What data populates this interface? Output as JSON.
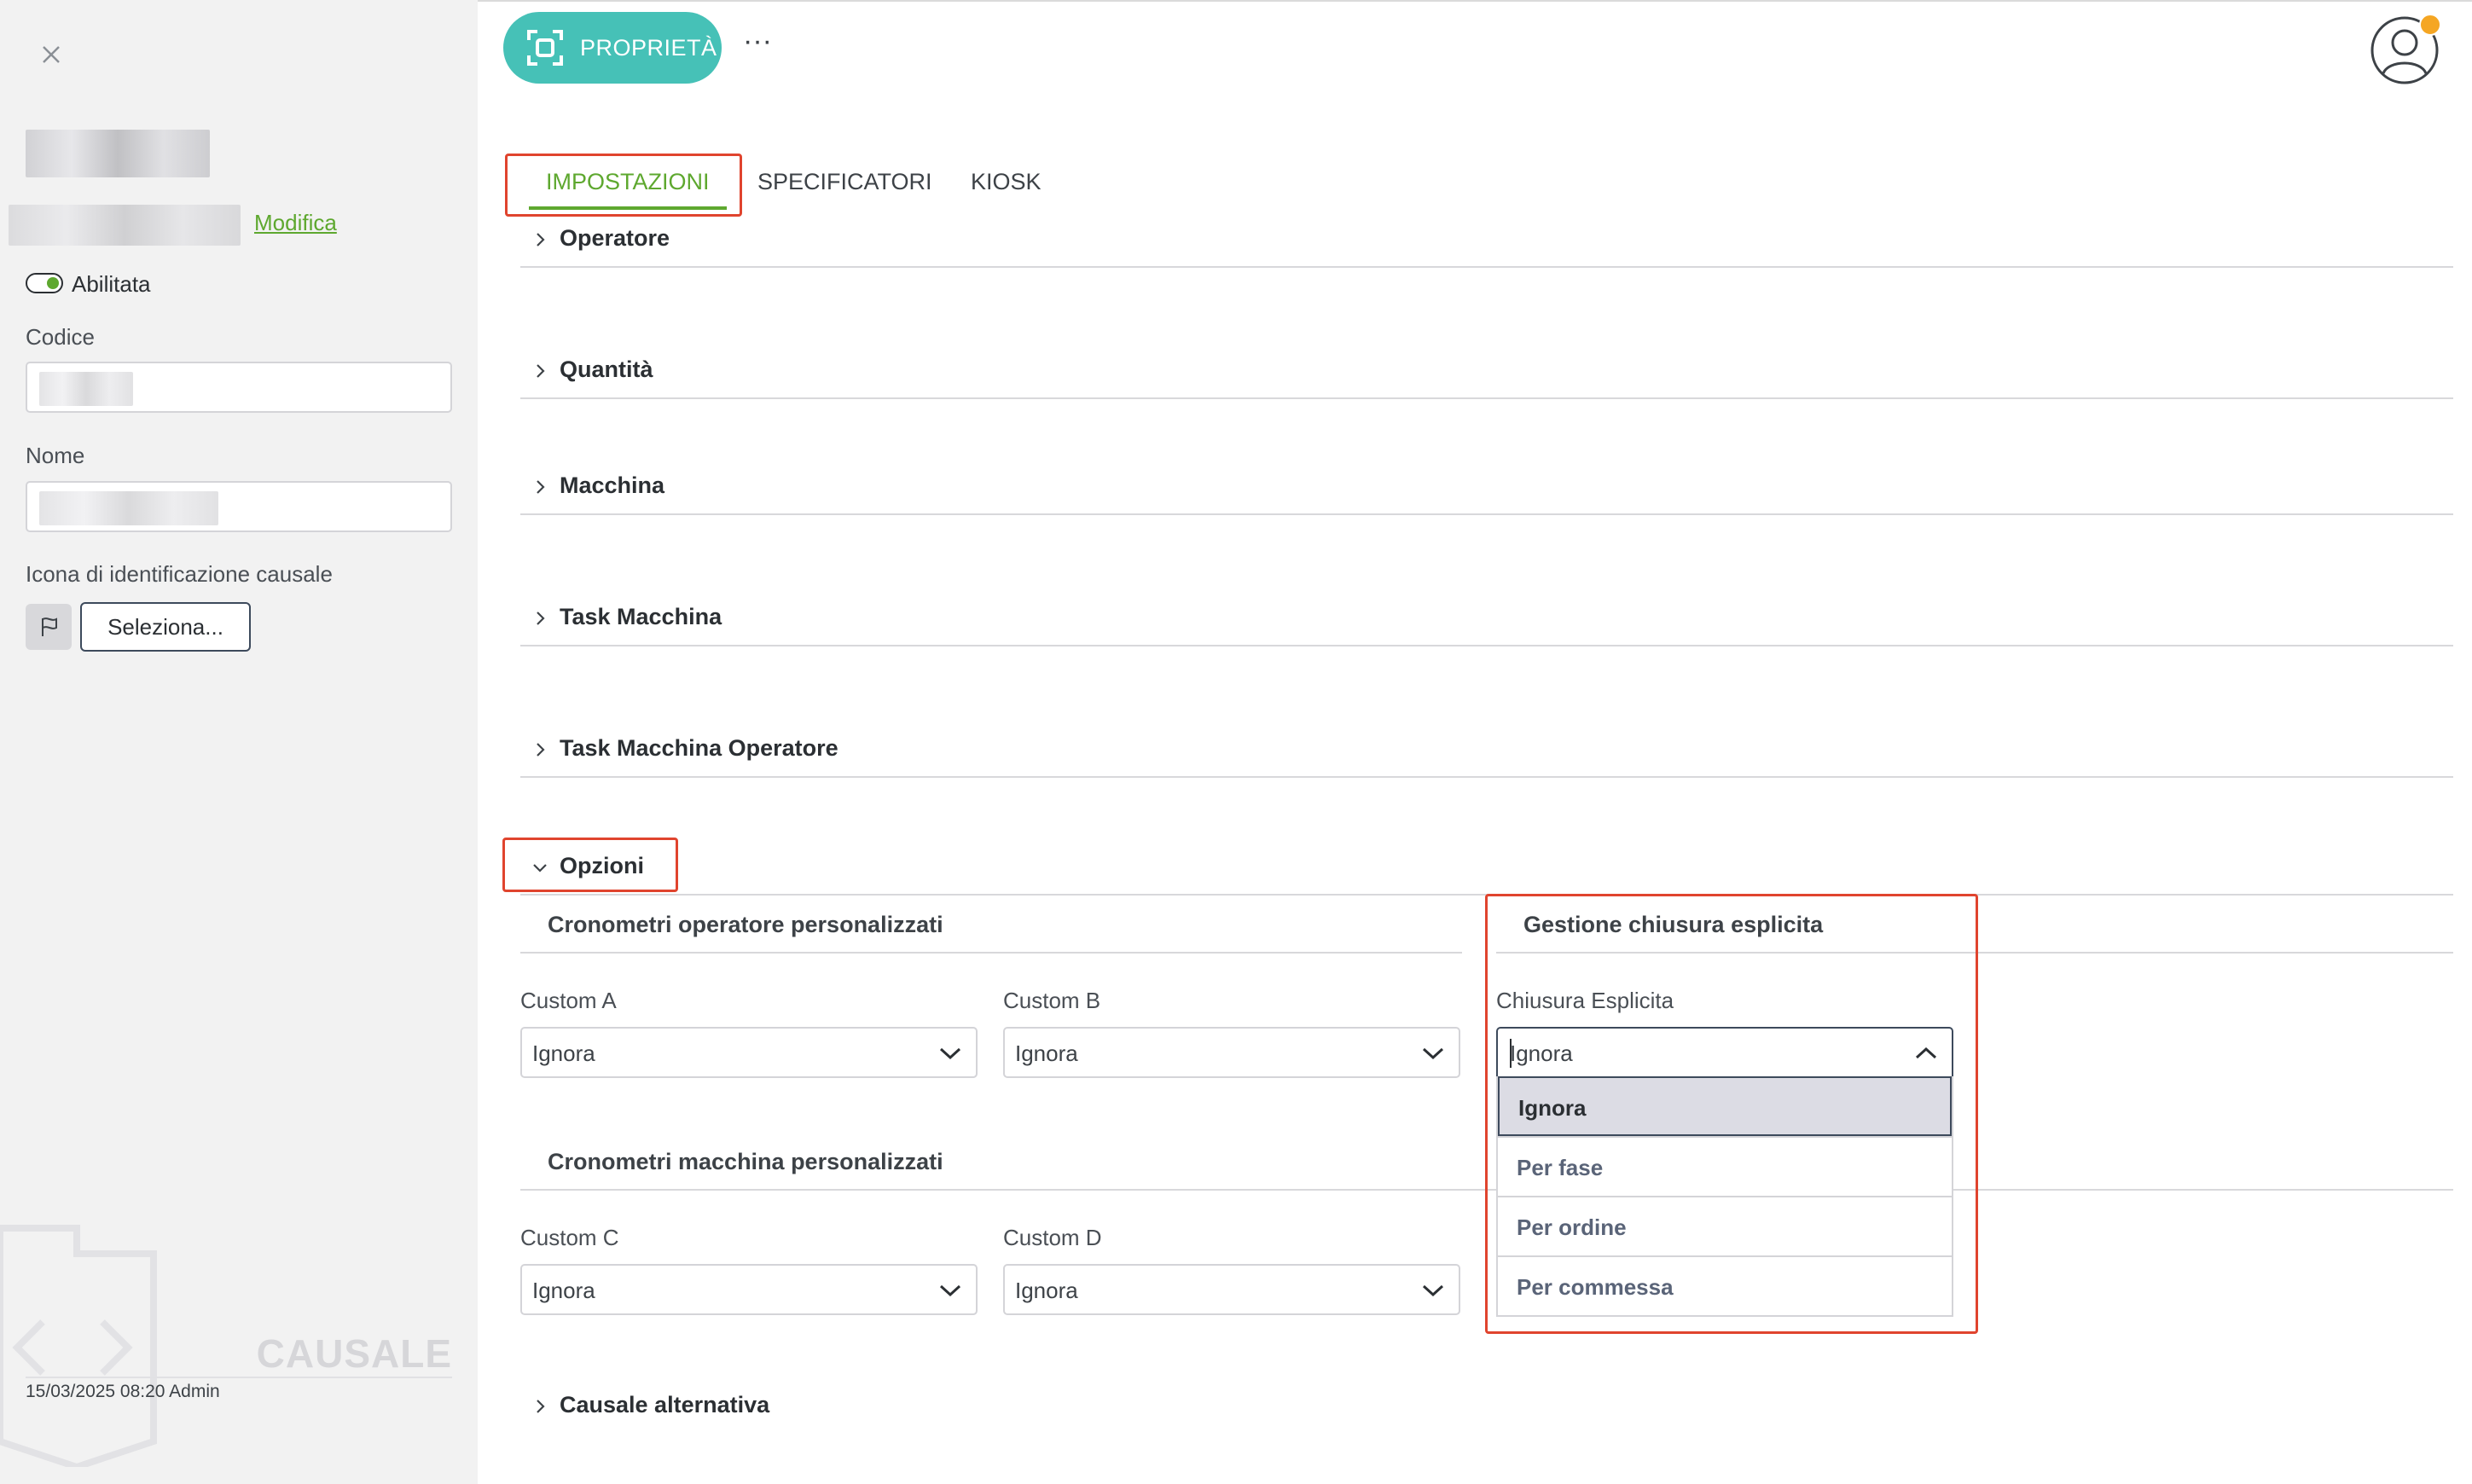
{
  "sidebar": {
    "modifica_label": "Modifica",
    "toggle_label": "Abilitata",
    "codice_label": "Codice",
    "nome_label": "Nome",
    "icona_label": "Icona di identificazione causale",
    "seleziona_label": "Seleziona...",
    "watermark": "CAUSALE",
    "footer_meta": "15/03/2025 08:20 Admin"
  },
  "header": {
    "proprieta_label": "PROPRIETÀ",
    "more_label": "···"
  },
  "tabs": [
    {
      "label": "IMPOSTAZIONI"
    },
    {
      "label": "SPECIFICATORI"
    },
    {
      "label": "KIOSK"
    }
  ],
  "sections": {
    "operatore": "Operatore",
    "quantita": "Quantità",
    "macchina": "Macchina",
    "task_macchina": "Task Macchina",
    "task_macchina_operatore": "Task Macchina Operatore",
    "opzioni": "Opzioni",
    "causale_alternativa": "Causale alternativa"
  },
  "opzioni": {
    "cron_operatore_title": "Cronometri operatore personalizzati",
    "cron_macchina_title": "Cronometri macchina personalizzati",
    "gestione_title": "Gestione chiusura esplicita",
    "custom_a": {
      "label": "Custom A",
      "value": "Ignora"
    },
    "custom_b": {
      "label": "Custom B",
      "value": "Ignora"
    },
    "custom_c": {
      "label": "Custom C",
      "value": "Ignora"
    },
    "custom_d": {
      "label": "Custom D",
      "value": "Ignora"
    },
    "chiusura": {
      "label": "Chiusura Esplicita",
      "value": "Ignora",
      "options": [
        "Ignora",
        "Per fase",
        "Per ordine",
        "Per commessa"
      ]
    }
  },
  "colors": {
    "accent_green": "#5ea82f",
    "teal_button": "#46c1b7",
    "highlight_red": "#e0442e"
  }
}
